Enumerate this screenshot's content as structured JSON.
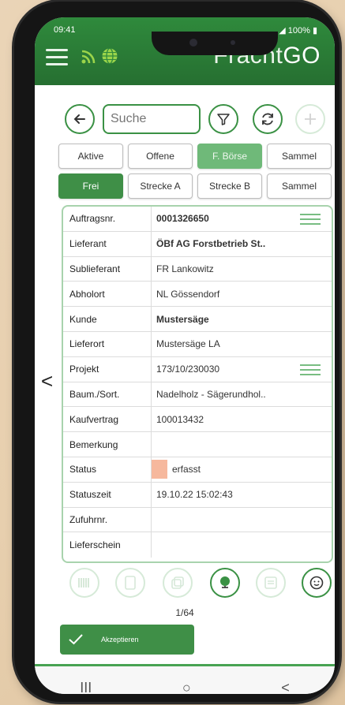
{
  "status_bar": {
    "time": "09:41",
    "battery": "100%"
  },
  "header": {
    "logo_left": "Fracht",
    "logo_right": "GO"
  },
  "toolbar": {
    "search_placeholder": "Suche"
  },
  "tabs_primary": [
    {
      "label": "Aktive",
      "active": false
    },
    {
      "label": "Offene",
      "active": false
    },
    {
      "label": "F. Börse",
      "active": true
    },
    {
      "label": "Sammel",
      "active": false
    }
  ],
  "tabs_secondary": [
    {
      "label": "Frei",
      "active": true
    },
    {
      "label": "Strecke A",
      "active": false
    },
    {
      "label": "Strecke B",
      "active": false
    },
    {
      "label": "Sammel",
      "active": false
    }
  ],
  "details": {
    "auftragsnr_label": "Auftragsnr.",
    "auftragsnr_value": "0001326650",
    "lieferant_label": "Lieferant",
    "lieferant_value": "ÖBf AG Forstbetrieb  St..",
    "sublieferant_label": "Sublieferant",
    "sublieferant_value": "FR Lankowitz",
    "abholort_label": "Abholort",
    "abholort_value": "NL Gössendorf",
    "kunde_label": "Kunde",
    "kunde_value": "Mustersäge",
    "lieferort_label": "Lieferort",
    "lieferort_value": "Mustersäge LA",
    "projekt_label": "Projekt",
    "projekt_value": "173/10/230030",
    "baum_label": "Baum./Sort.",
    "baum_value": "Nadelholz - Sägerundhol..",
    "kaufvertrag_label": "Kaufvertrag",
    "kaufvertrag_value": "100013432",
    "bemerkung_label": "Bemerkung",
    "bemerkung_value": "",
    "status_label": "Status",
    "status_value": "erfasst",
    "statuszeit_label": "Statuszeit",
    "statuszeit_value": "19.10.22 15:02:43",
    "zufuhrnr_label": "Zufuhrnr.",
    "zufuhrnr_value": "",
    "lieferschein_label": "Lieferschein",
    "lieferschein_value": ""
  },
  "nav": {
    "prev": "<",
    "next": ">"
  },
  "pager": {
    "text": "1/64"
  },
  "accept": {
    "label": "Akzeptieren"
  },
  "system_nav": {
    "recents": "III",
    "home": "○",
    "back": "<"
  },
  "colors": {
    "brand_green": "#3f8f47",
    "status_swatch": "#f6b89d"
  }
}
